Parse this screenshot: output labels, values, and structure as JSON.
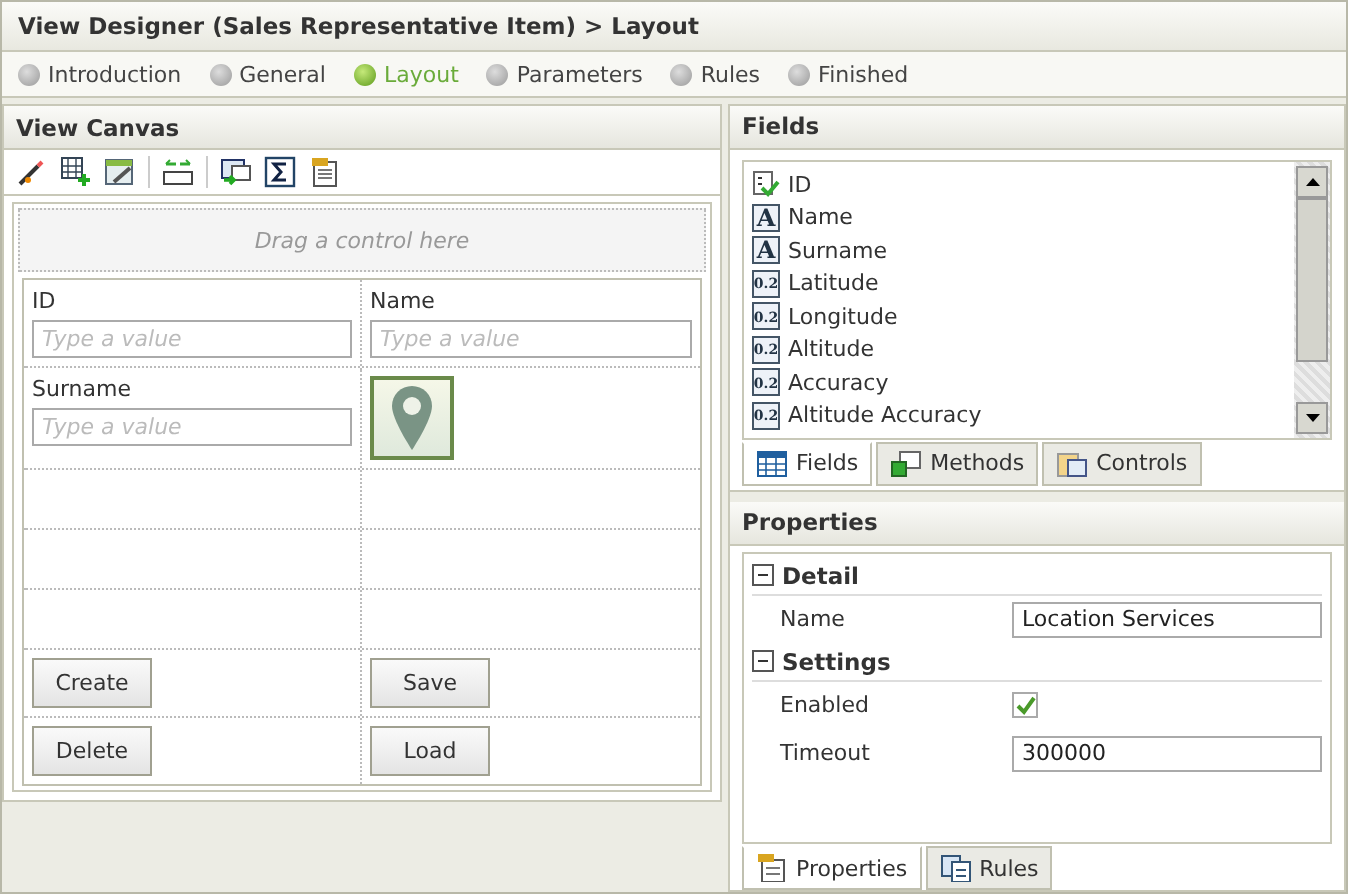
{
  "window": {
    "title": "View Designer (Sales Representative Item) > Layout"
  },
  "steps": [
    {
      "label": "Introduction",
      "selected": false
    },
    {
      "label": "General",
      "selected": false
    },
    {
      "label": "Layout",
      "selected": true
    },
    {
      "label": "Parameters",
      "selected": false
    },
    {
      "label": "Rules",
      "selected": false
    },
    {
      "label": "Finished",
      "selected": false
    }
  ],
  "canvas": {
    "title": "View Canvas",
    "drop_hint": "Drag a control here",
    "rows": [
      {
        "kind": "fields",
        "cells": [
          {
            "label": "ID",
            "placeholder": "Type a value"
          },
          {
            "label": "Name",
            "placeholder": "Type a value"
          }
        ]
      },
      {
        "kind": "mixed",
        "cells": [
          {
            "label": "Surname",
            "placeholder": "Type a value"
          },
          {
            "kind": "location"
          }
        ]
      },
      {
        "kind": "empty"
      },
      {
        "kind": "empty"
      },
      {
        "kind": "empty"
      },
      {
        "kind": "buttons",
        "cells": [
          {
            "label": "Create"
          },
          {
            "label": "Save"
          }
        ]
      },
      {
        "kind": "buttons",
        "cells": [
          {
            "label": "Delete"
          },
          {
            "label": "Load"
          }
        ]
      }
    ]
  },
  "fields": {
    "title": "Fields",
    "items": [
      {
        "label": "ID",
        "kind": "key"
      },
      {
        "label": "Name",
        "kind": "text",
        "icon": "A"
      },
      {
        "label": "Surname",
        "kind": "text",
        "icon": "A"
      },
      {
        "label": "Latitude",
        "kind": "number",
        "icon": "0.2"
      },
      {
        "label": "Longitude",
        "kind": "number",
        "icon": "0.2"
      },
      {
        "label": "Altitude",
        "kind": "number",
        "icon": "0.2"
      },
      {
        "label": "Accuracy",
        "kind": "number",
        "icon": "0.2"
      },
      {
        "label": "Altitude Accuracy",
        "kind": "number",
        "icon": "0.2"
      }
    ],
    "tabs": [
      {
        "label": "Fields",
        "selected": true
      },
      {
        "label": "Methods",
        "selected": false
      },
      {
        "label": "Controls",
        "selected": false
      }
    ]
  },
  "properties": {
    "title": "Properties",
    "groups": [
      {
        "title": "Detail",
        "expanded": true,
        "items": [
          {
            "label": "Name",
            "kind": "text",
            "value": "Location Services"
          }
        ]
      },
      {
        "title": "Settings",
        "expanded": true,
        "items": [
          {
            "label": "Enabled",
            "kind": "checkbox",
            "checked": true
          },
          {
            "label": "Timeout",
            "kind": "text",
            "value": "300000"
          }
        ]
      }
    ],
    "tabs": [
      {
        "label": "Properties",
        "selected": true
      },
      {
        "label": "Rules",
        "selected": false
      }
    ]
  }
}
